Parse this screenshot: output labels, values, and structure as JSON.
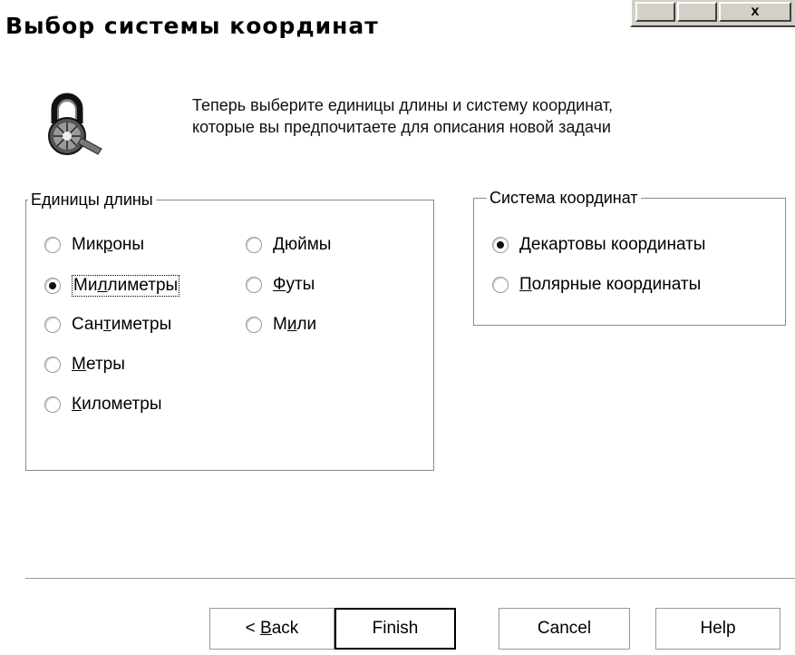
{
  "window": {
    "title": "Выбор системы координат",
    "close_glyph": "x"
  },
  "intro": {
    "icon": "lock-magnifier-icon",
    "line1": "Теперь выберите единицы длины и систему координат,",
    "line2": "которые вы предпочитаете для описания новой задачи"
  },
  "units": {
    "legend": "Единицы длины",
    "options": [
      {
        "pre": "Мик",
        "u": "р",
        "post": "оны",
        "selected": false
      },
      {
        "pre": "Ми",
        "u": "л",
        "post": "лиметры",
        "selected": true
      },
      {
        "pre": "Сан",
        "u": "т",
        "post": "иметры",
        "selected": false
      },
      {
        "pre": "",
        "u": "М",
        "post": "етры",
        "selected": false
      },
      {
        "pre": "",
        "u": "К",
        "post": "илометры",
        "selected": false
      },
      {
        "pre": "",
        "u": "Д",
        "post": "юймы",
        "selected": false
      },
      {
        "pre": "",
        "u": "Ф",
        "post": "уты",
        "selected": false
      },
      {
        "pre": "М",
        "u": "и",
        "post": "ли",
        "selected": false
      }
    ]
  },
  "coords": {
    "legend": "Система координат",
    "options": [
      {
        "pre": "",
        "u": "Д",
        "post": "екартовы координаты",
        "selected": true
      },
      {
        "pre": "",
        "u": "П",
        "post": "олярные координаты",
        "selected": false
      }
    ]
  },
  "buttons": {
    "back_prefix": "< ",
    "back_u": "B",
    "back_rest": "ack",
    "finish": "Finish",
    "cancel": "Cancel",
    "help": "Help"
  }
}
